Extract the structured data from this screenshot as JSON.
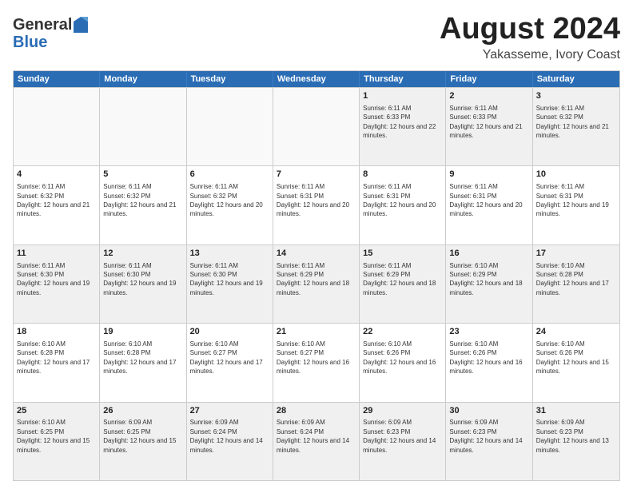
{
  "logo": {
    "general": "General",
    "blue": "Blue"
  },
  "title": "August 2024",
  "subtitle": "Yakasseme, Ivory Coast",
  "days": [
    "Sunday",
    "Monday",
    "Tuesday",
    "Wednesday",
    "Thursday",
    "Friday",
    "Saturday"
  ],
  "weeks": [
    [
      {
        "day": "",
        "empty": true
      },
      {
        "day": "",
        "empty": true
      },
      {
        "day": "",
        "empty": true
      },
      {
        "day": "",
        "empty": true
      },
      {
        "day": "1",
        "sunrise": "6:11 AM",
        "sunset": "6:33 PM",
        "daylight": "12 hours and 22 minutes."
      },
      {
        "day": "2",
        "sunrise": "6:11 AM",
        "sunset": "6:33 PM",
        "daylight": "12 hours and 21 minutes."
      },
      {
        "day": "3",
        "sunrise": "6:11 AM",
        "sunset": "6:32 PM",
        "daylight": "12 hours and 21 minutes."
      }
    ],
    [
      {
        "day": "4",
        "sunrise": "6:11 AM",
        "sunset": "6:32 PM",
        "daylight": "12 hours and 21 minutes."
      },
      {
        "day": "5",
        "sunrise": "6:11 AM",
        "sunset": "6:32 PM",
        "daylight": "12 hours and 21 minutes."
      },
      {
        "day": "6",
        "sunrise": "6:11 AM",
        "sunset": "6:32 PM",
        "daylight": "12 hours and 20 minutes."
      },
      {
        "day": "7",
        "sunrise": "6:11 AM",
        "sunset": "6:31 PM",
        "daylight": "12 hours and 20 minutes."
      },
      {
        "day": "8",
        "sunrise": "6:11 AM",
        "sunset": "6:31 PM",
        "daylight": "12 hours and 20 minutes."
      },
      {
        "day": "9",
        "sunrise": "6:11 AM",
        "sunset": "6:31 PM",
        "daylight": "12 hours and 20 minutes."
      },
      {
        "day": "10",
        "sunrise": "6:11 AM",
        "sunset": "6:31 PM",
        "daylight": "12 hours and 19 minutes."
      }
    ],
    [
      {
        "day": "11",
        "sunrise": "6:11 AM",
        "sunset": "6:30 PM",
        "daylight": "12 hours and 19 minutes."
      },
      {
        "day": "12",
        "sunrise": "6:11 AM",
        "sunset": "6:30 PM",
        "daylight": "12 hours and 19 minutes."
      },
      {
        "day": "13",
        "sunrise": "6:11 AM",
        "sunset": "6:30 PM",
        "daylight": "12 hours and 19 minutes."
      },
      {
        "day": "14",
        "sunrise": "6:11 AM",
        "sunset": "6:29 PM",
        "daylight": "12 hours and 18 minutes."
      },
      {
        "day": "15",
        "sunrise": "6:11 AM",
        "sunset": "6:29 PM",
        "daylight": "12 hours and 18 minutes."
      },
      {
        "day": "16",
        "sunrise": "6:10 AM",
        "sunset": "6:29 PM",
        "daylight": "12 hours and 18 minutes."
      },
      {
        "day": "17",
        "sunrise": "6:10 AM",
        "sunset": "6:28 PM",
        "daylight": "12 hours and 17 minutes."
      }
    ],
    [
      {
        "day": "18",
        "sunrise": "6:10 AM",
        "sunset": "6:28 PM",
        "daylight": "12 hours and 17 minutes."
      },
      {
        "day": "19",
        "sunrise": "6:10 AM",
        "sunset": "6:28 PM",
        "daylight": "12 hours and 17 minutes."
      },
      {
        "day": "20",
        "sunrise": "6:10 AM",
        "sunset": "6:27 PM",
        "daylight": "12 hours and 17 minutes."
      },
      {
        "day": "21",
        "sunrise": "6:10 AM",
        "sunset": "6:27 PM",
        "daylight": "12 hours and 16 minutes."
      },
      {
        "day": "22",
        "sunrise": "6:10 AM",
        "sunset": "6:26 PM",
        "daylight": "12 hours and 16 minutes."
      },
      {
        "day": "23",
        "sunrise": "6:10 AM",
        "sunset": "6:26 PM",
        "daylight": "12 hours and 16 minutes."
      },
      {
        "day": "24",
        "sunrise": "6:10 AM",
        "sunset": "6:26 PM",
        "daylight": "12 hours and 15 minutes."
      }
    ],
    [
      {
        "day": "25",
        "sunrise": "6:10 AM",
        "sunset": "6:25 PM",
        "daylight": "12 hours and 15 minutes."
      },
      {
        "day": "26",
        "sunrise": "6:09 AM",
        "sunset": "6:25 PM",
        "daylight": "12 hours and 15 minutes."
      },
      {
        "day": "27",
        "sunrise": "6:09 AM",
        "sunset": "6:24 PM",
        "daylight": "12 hours and 14 minutes."
      },
      {
        "day": "28",
        "sunrise": "6:09 AM",
        "sunset": "6:24 PM",
        "daylight": "12 hours and 14 minutes."
      },
      {
        "day": "29",
        "sunrise": "6:09 AM",
        "sunset": "6:23 PM",
        "daylight": "12 hours and 14 minutes."
      },
      {
        "day": "30",
        "sunrise": "6:09 AM",
        "sunset": "6:23 PM",
        "daylight": "12 hours and 14 minutes."
      },
      {
        "day": "31",
        "sunrise": "6:09 AM",
        "sunset": "6:23 PM",
        "daylight": "12 hours and 13 minutes."
      }
    ]
  ]
}
